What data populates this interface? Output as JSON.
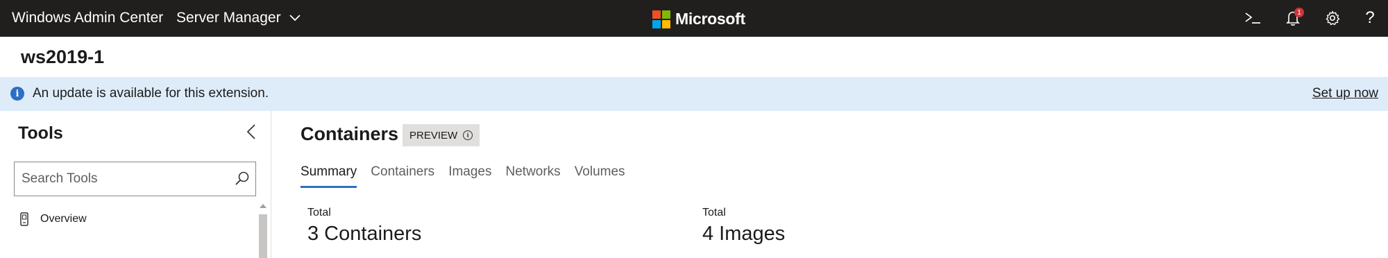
{
  "topbar": {
    "app_title": "Windows Admin Center",
    "server_manager_label": "Server Manager",
    "brand_name": "Microsoft",
    "brand_colors": [
      "#f25022",
      "#7fba00",
      "#00a4ef",
      "#ffb900"
    ],
    "notification_count": "1",
    "help_glyph": "?",
    "icons": [
      "powershell-icon",
      "notification-bell-icon",
      "settings-gear-icon",
      "help-icon"
    ]
  },
  "server": {
    "name": "ws2019-1"
  },
  "banner": {
    "info_glyph": "i",
    "message": "An update is available for this extension.",
    "link_label": "Set up now"
  },
  "tools": {
    "title": "Tools",
    "search_placeholder": "Search Tools",
    "search_value": "",
    "items": [
      {
        "label": "Overview",
        "icon": "device-icon"
      }
    ]
  },
  "main": {
    "title": "Containers",
    "preview_label": "PREVIEW",
    "preview_info_glyph": "i",
    "tabs": [
      {
        "label": "Summary",
        "active": true
      },
      {
        "label": "Containers",
        "active": false
      },
      {
        "label": "Images",
        "active": false
      },
      {
        "label": "Networks",
        "active": false
      },
      {
        "label": "Volumes",
        "active": false
      }
    ],
    "stats": [
      {
        "label": "Total",
        "value": "3 Containers"
      },
      {
        "label": "Total",
        "value": "4 Images"
      }
    ]
  },
  "colors": {
    "topbar_bg": "#201f1e",
    "banner_bg": "#deecf9",
    "accent": "#2c6fc5",
    "badge_red": "#d13438"
  }
}
